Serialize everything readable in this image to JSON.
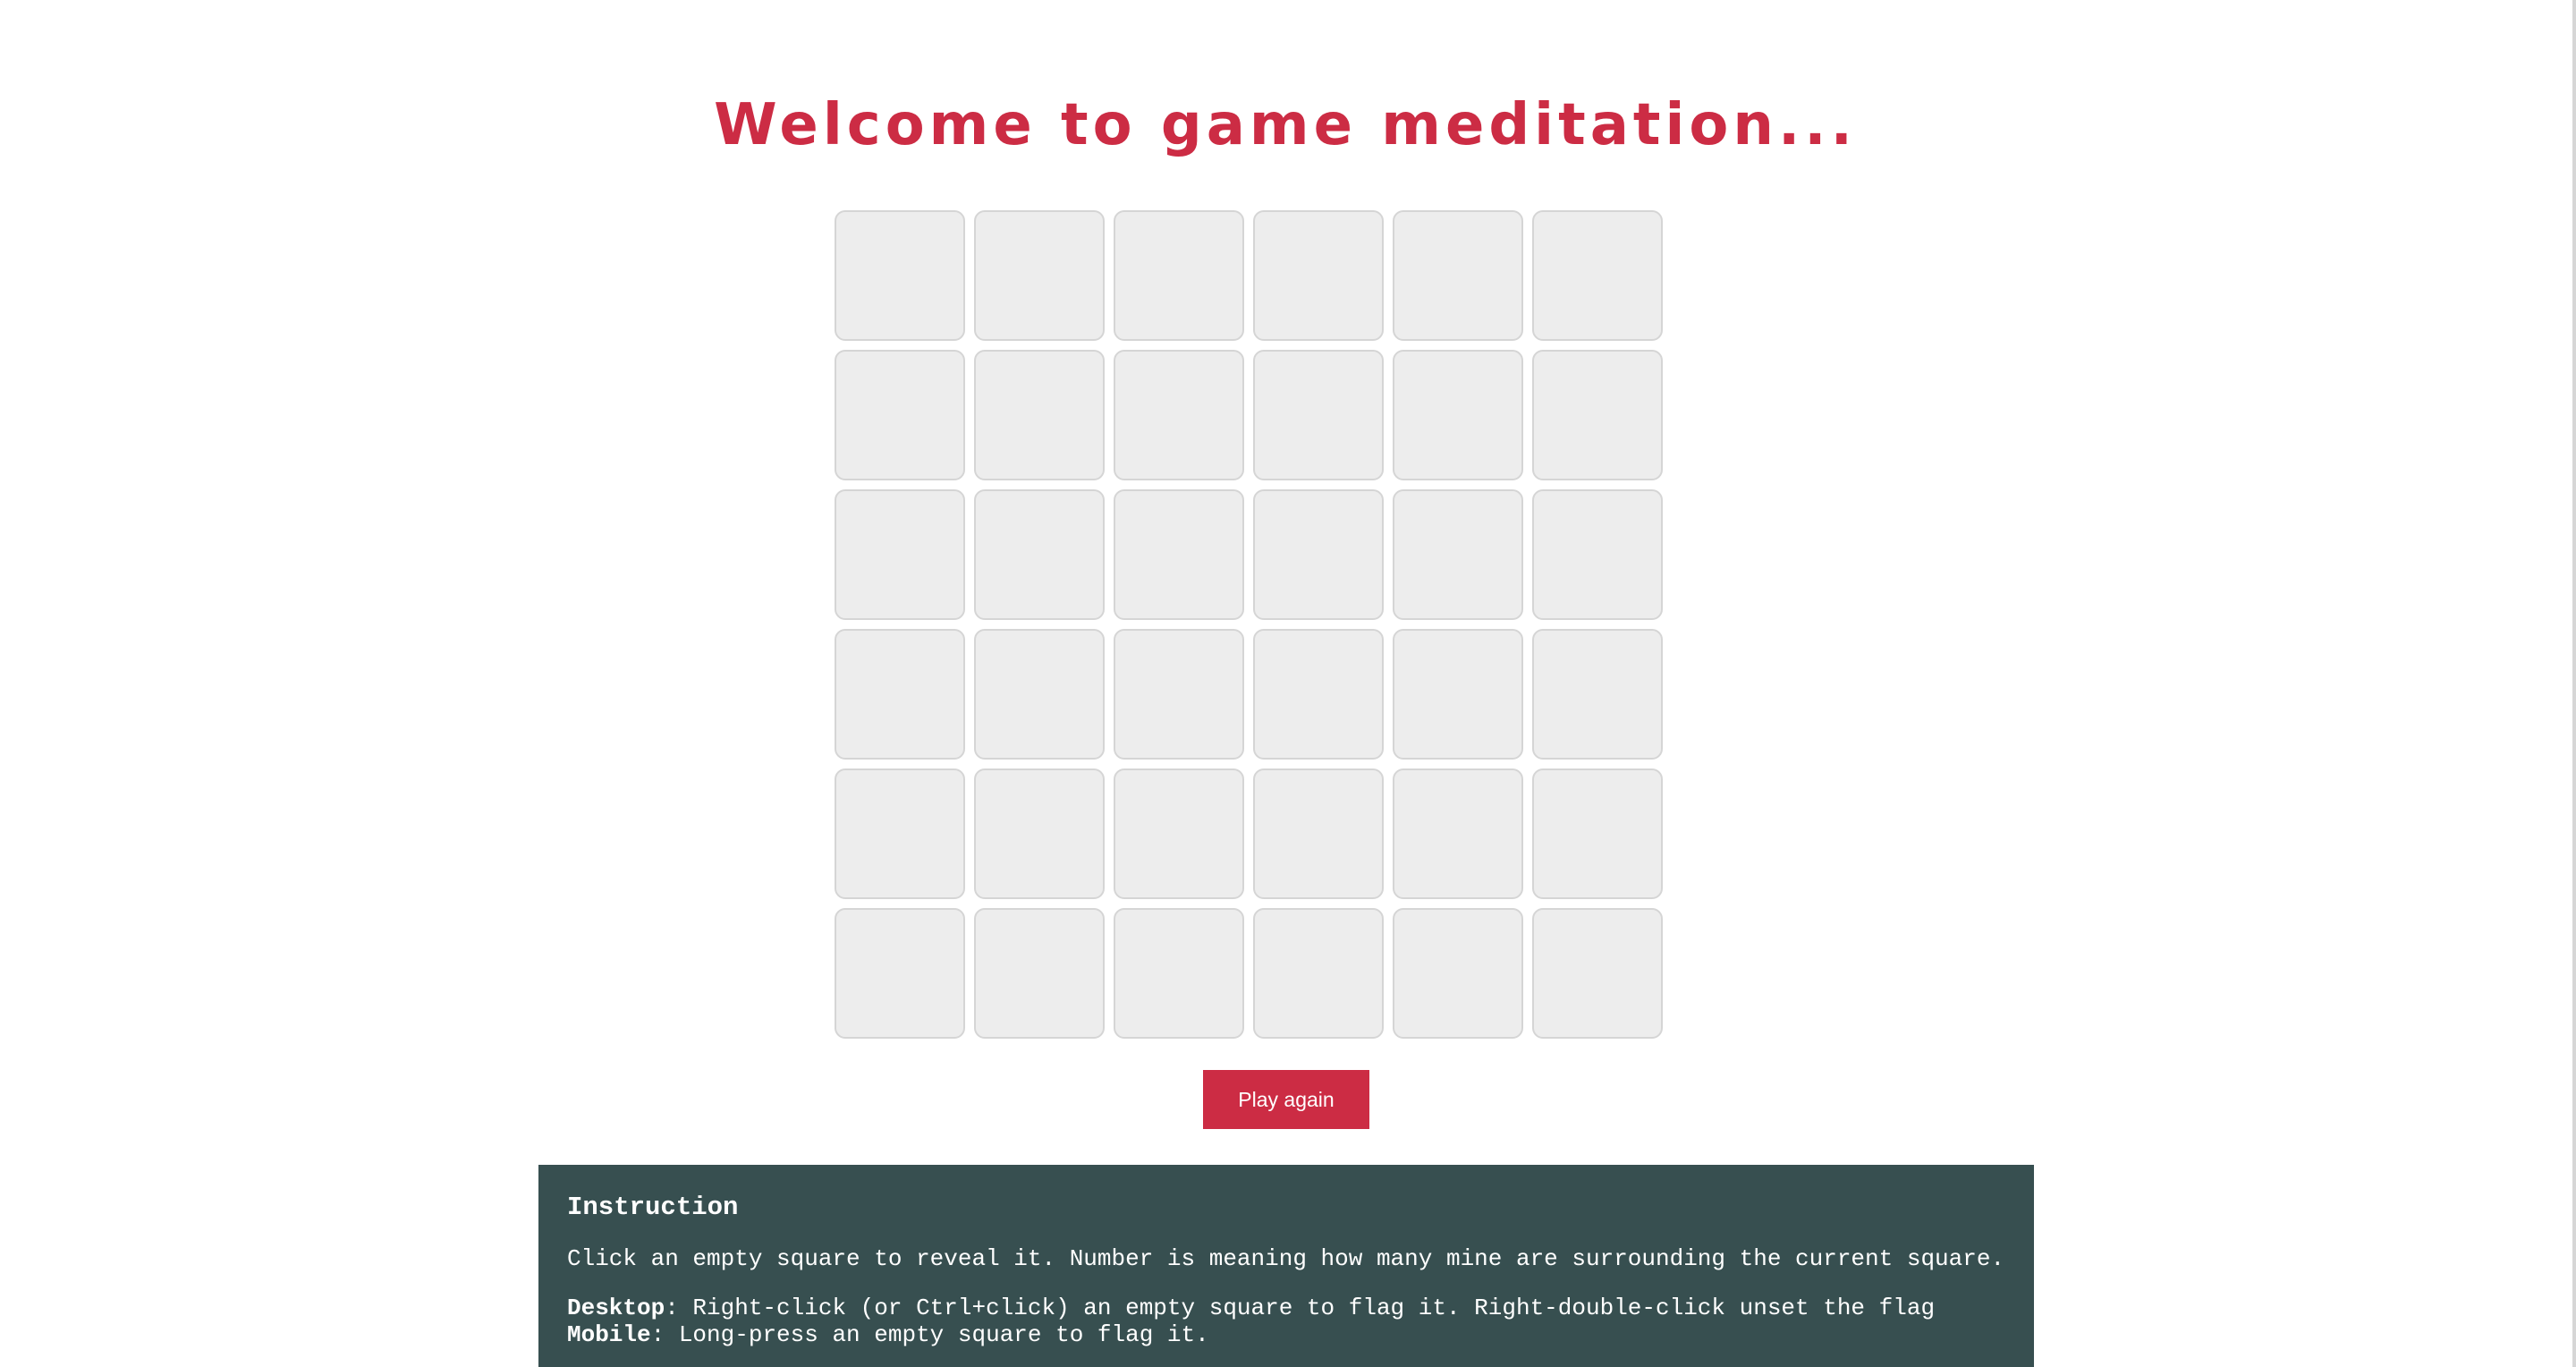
{
  "title": "Welcome to game meditation...",
  "board": {
    "rows": 6,
    "cols": 6,
    "cells": [
      [
        "",
        "",
        "",
        "",
        "",
        ""
      ],
      [
        "",
        "",
        "",
        "",
        "",
        ""
      ],
      [
        "",
        "",
        "",
        "",
        "",
        ""
      ],
      [
        "",
        "",
        "",
        "",
        "",
        ""
      ],
      [
        "",
        "",
        "",
        "",
        "",
        ""
      ],
      [
        "",
        "",
        "",
        "",
        "",
        ""
      ]
    ]
  },
  "play_again_label": "Play again",
  "instruction": {
    "heading": "Instruction",
    "text": "Click an empty square to reveal it. Number is meaning how many mine are surrounding the current square.",
    "desktop_label": "Desktop",
    "desktop_text": ": Right-click (or Ctrl+click) an empty square to flag it. Right-double-click unset the flag",
    "mobile_label": "Mobile",
    "mobile_text": ": Long-press an empty square to flag it."
  },
  "colors": {
    "accent": "#cc2c44",
    "panel": "#374f50",
    "cell": "#ededed",
    "cell_border": "#d5d5d5"
  }
}
